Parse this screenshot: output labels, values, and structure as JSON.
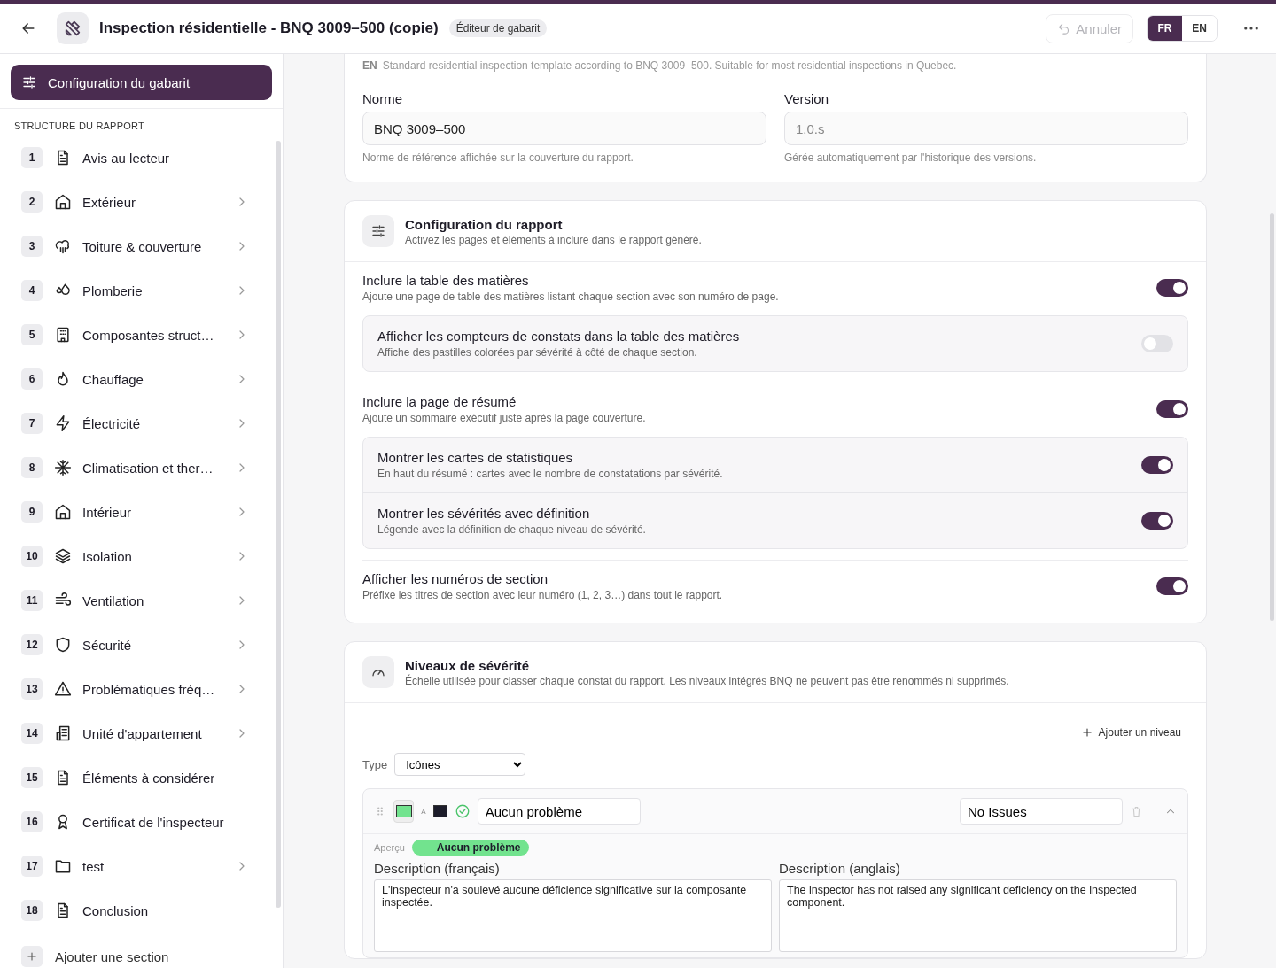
{
  "header": {
    "title": "Inspection résidentielle - BNQ 3009–500 (copie)",
    "badge": "Éditeur de gabarit",
    "undo_label": "Annuler",
    "languages": [
      {
        "label": "FR",
        "selected": true
      },
      {
        "label": "EN",
        "selected": false
      }
    ]
  },
  "sidebar": {
    "config_button": "Configuration du gabarit",
    "section_heading": "STRUCTURE DU RAPPORT",
    "items": [
      {
        "number": "1",
        "label": "Avis au lecteur",
        "expandable": false
      },
      {
        "number": "2",
        "label": "Extérieur",
        "expandable": true
      },
      {
        "number": "3",
        "label": "Toiture & couverture",
        "expandable": true
      },
      {
        "number": "4",
        "label": "Plomberie",
        "expandable": true
      },
      {
        "number": "5",
        "label": "Composantes struct…",
        "expandable": true
      },
      {
        "number": "6",
        "label": "Chauffage",
        "expandable": true
      },
      {
        "number": "7",
        "label": "Électricité",
        "expandable": true
      },
      {
        "number": "8",
        "label": "Climatisation et ther…",
        "expandable": true
      },
      {
        "number": "9",
        "label": "Intérieur",
        "expandable": true
      },
      {
        "number": "10",
        "label": "Isolation",
        "expandable": true
      },
      {
        "number": "11",
        "label": "Ventilation",
        "expandable": true
      },
      {
        "number": "12",
        "label": "Sécurité",
        "expandable": true
      },
      {
        "number": "13",
        "label": "Problématiques fréq…",
        "expandable": true
      },
      {
        "number": "14",
        "label": "Unité d'appartement",
        "expandable": true
      },
      {
        "number": "15",
        "label": "Éléments à considérer",
        "expandable": false
      },
      {
        "number": "16",
        "label": "Certificat de l'inspecteur",
        "expandable": false
      },
      {
        "number": "17",
        "label": "test",
        "expandable": true
      },
      {
        "number": "18",
        "label": "Conclusion",
        "expandable": false
      }
    ],
    "add_label": "Ajouter une section"
  },
  "description_card": {
    "language": "EN",
    "description": "Standard residential inspection template according to BNQ 3009–500. Suitable for most residential inspections in Quebec.",
    "fields": [
      {
        "label": "Norme",
        "value": "BNQ 3009–500",
        "hint": "Norme de référence affichée sur la couverture du rapport.",
        "disabled": false
      },
      {
        "label": "Version",
        "value": "1.0.s",
        "hint": "Gérée automatiquement par l'historique des versions.",
        "disabled": true
      }
    ]
  },
  "report_config": {
    "title": "Configuration du rapport",
    "subtitle": "Activez les pages et éléments à inclure dans le rapport généré.",
    "options": [
      {
        "label": "Inclure la table des matières",
        "description": "Ajoute une page de table des matières listant chaque section avec son numéro de page.",
        "on": true,
        "children": [
          {
            "label": "Afficher les compteurs de constats dans la table des matières",
            "description": "Affiche des pastilles colorées par sévérité à côté de chaque section.",
            "on": false
          }
        ]
      },
      {
        "label": "Inclure la page de résumé",
        "description": "Ajoute un sommaire exécutif juste après la page couverture.",
        "on": true,
        "children": [
          {
            "label": "Montrer les cartes de statistiques",
            "description": "En haut du résumé : cartes avec le nombre de constatations par sévérité.",
            "on": true
          },
          {
            "label": "Montrer les sévérités avec définition",
            "description": "Légende avec la définition de chaque niveau de sévérité.",
            "on": true
          }
        ]
      },
      {
        "label": "Afficher les numéros de section",
        "description": "Préfixe les titres de section avec leur numéro (1, 2, 3…) dans tout le rapport.",
        "on": true
      }
    ]
  },
  "severity": {
    "title": "Niveaux de sévérité",
    "subtitle": "Échelle utilisée pour classer chaque constat du rapport. Les niveaux intégrés BNQ ne peuvent pas être renommés ni supprimés.",
    "add_label": "Ajouter un niveau",
    "type_label": "Type",
    "type_value": "Icônes",
    "levels": [
      {
        "color": "#72e38e",
        "text_swatch": {
          "color": "#1c1c2a"
        },
        "text_color_label": "A",
        "name_fr": "Aucun problème",
        "name_en": "No Issues",
        "preview_label": "Aperçu",
        "preview_text": "Aucun problème",
        "description_fr_label": "Description (français)",
        "description_fr": "L'inspecteur n'a soulevé aucune déficience significative sur la composante inspectée.",
        "description_en_label": "Description (anglais)",
        "description_en": "The inspector has not raised any significant deficiency on the inspected component."
      }
    ]
  }
}
